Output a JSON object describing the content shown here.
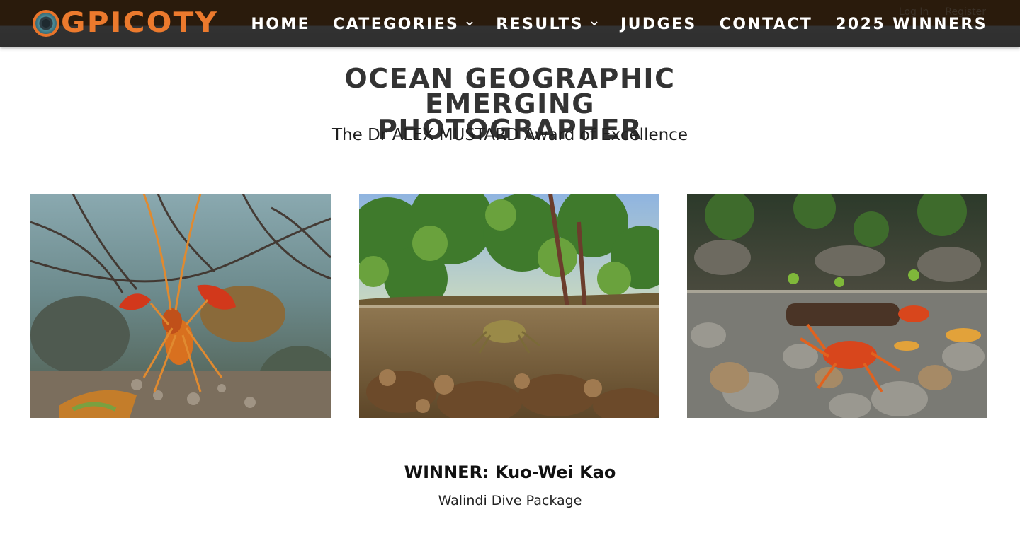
{
  "header": {
    "logo_text": "GPICOTY",
    "auth": {
      "login": "Log In",
      "register": "Register"
    },
    "nav": [
      {
        "label": "HOME",
        "dropdown": false
      },
      {
        "label": "CATEGORIES",
        "dropdown": true
      },
      {
        "label": "RESULTS",
        "dropdown": true
      },
      {
        "label": "JUDGES",
        "dropdown": false
      },
      {
        "label": "CONTACT",
        "dropdown": false
      },
      {
        "label": "2025 WINNERS",
        "dropdown": false
      }
    ]
  },
  "main": {
    "title": "OCEAN GEOGRAPHIC EMERGING PHOTOGRAPHER",
    "subtitle": "The Dr ALEX MUSTARD Award of Excellence",
    "photos": [
      {
        "subject": "crayfish-underwater-photo"
      },
      {
        "subject": "crab-split-level-mangrove-photo"
      },
      {
        "subject": "red-crabs-split-level-stream-photo"
      }
    ],
    "winner": "WINNER: Kuo-Wei Kao",
    "prize": "Walindi Dive Package"
  },
  "colors": {
    "brand_orange": "#ec7a2d",
    "header_bg": "#2e2e2e",
    "title_text": "#333333"
  }
}
